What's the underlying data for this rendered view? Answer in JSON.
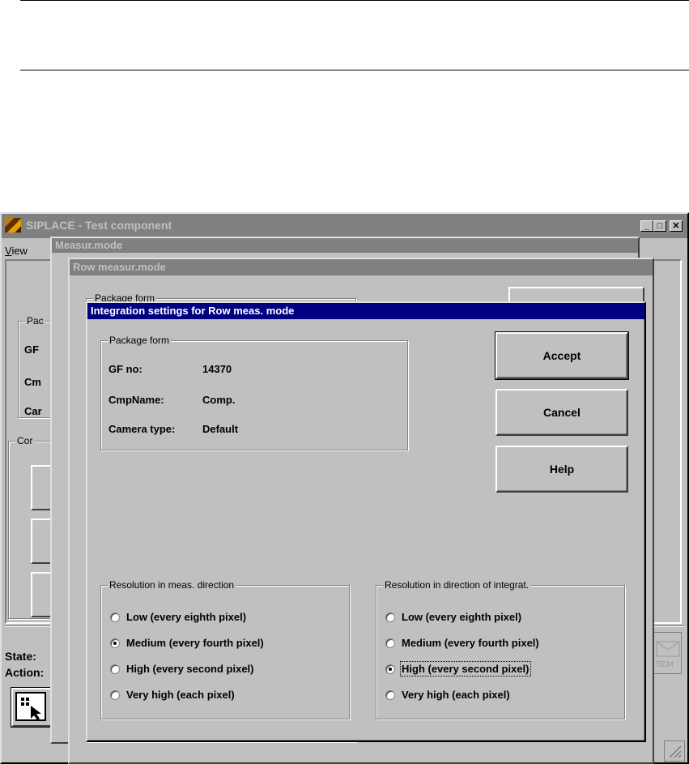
{
  "main_window": {
    "title": "SIPLACE - Test component",
    "menu_view": "View",
    "menu_view_hotkey": "V",
    "menu_view_rest": "iew",
    "package_group_partial": "Pac",
    "gf_partial": "GF",
    "cmp_partial": "Cm",
    "cam_partial": "Car",
    "con_group_partial": "Cor",
    "state_label": "State:",
    "action_label": "Action:",
    "sem_label": "SEM",
    "controls": {
      "minimize": "_",
      "maximize": "□",
      "close": "✕"
    }
  },
  "measur_window": {
    "title": "Measur.mode"
  },
  "row_window": {
    "title": "Row measur.mode",
    "package_group_partial": "Package form"
  },
  "dialog": {
    "title": "Integration settings for Row meas. mode",
    "package_group": {
      "title": "Package form",
      "rows": [
        {
          "label": "GF no:",
          "value": "14370"
        },
        {
          "label": "CmpName:",
          "value": "Comp."
        },
        {
          "label": "Camera type:",
          "value": "Default"
        }
      ]
    },
    "buttons": {
      "accept": "Accept",
      "cancel": "Cancel",
      "help": "Help"
    },
    "meas_group": {
      "title": "Resolution in meas. direction",
      "options": [
        "Low (every eighth pixel)",
        "Medium (every fourth pixel)",
        "High (every second pixel)",
        "Very high (each pixel)"
      ],
      "selected": "Medium (every fourth pixel)"
    },
    "integ_group": {
      "title": "Resolution in direction of integrat.",
      "options": [
        "Low (every eighth pixel)",
        "Medium (every fourth pixel)",
        "High (every second pixel)",
        "Very high (each pixel)"
      ],
      "selected": "High (every second pixel)"
    }
  },
  "colors": {
    "face": "#c0c0c0",
    "active_title": "#000080",
    "inactive_title": "#808080"
  }
}
